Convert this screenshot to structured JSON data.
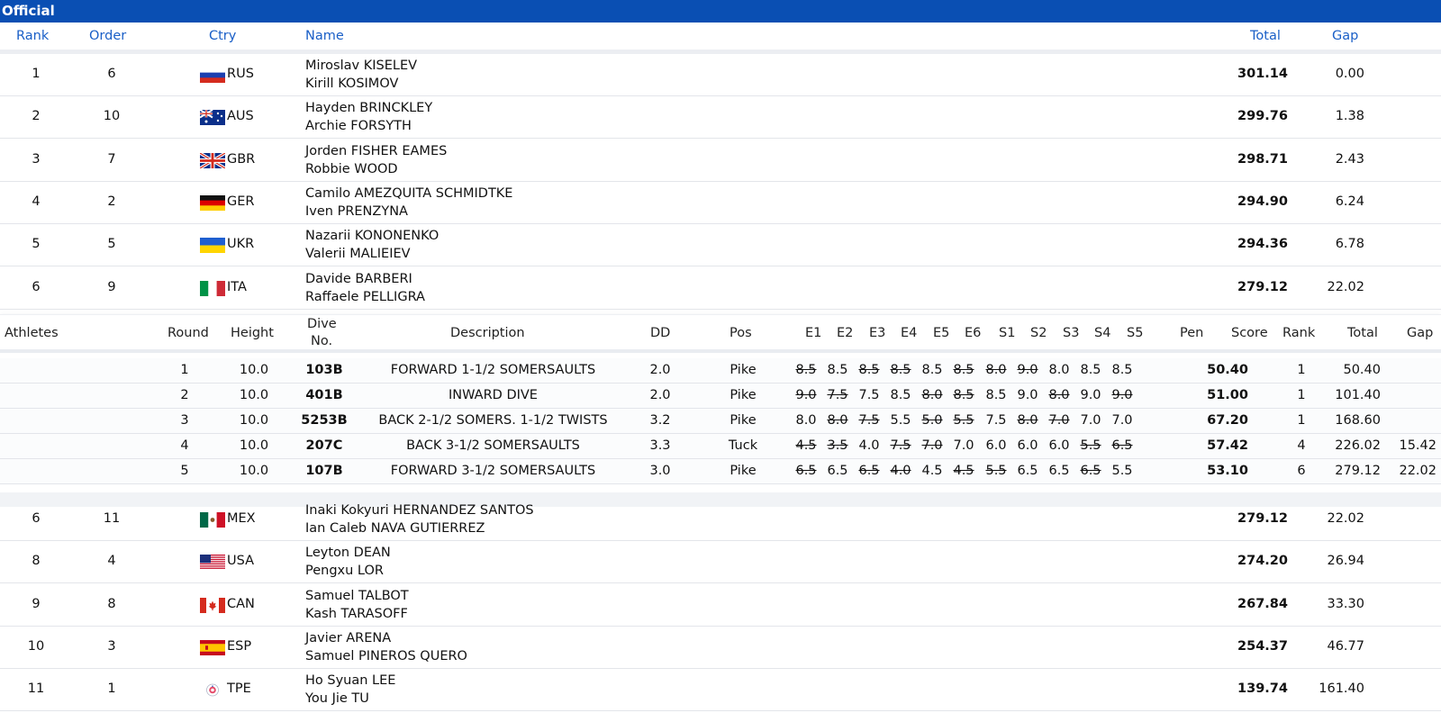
{
  "banner": {
    "title": "Official"
  },
  "columns": {
    "rank": "Rank",
    "order": "Order",
    "ctry": "Ctry",
    "name": "Name",
    "total": "Total",
    "gap": "Gap"
  },
  "results_top": [
    {
      "rank": "1",
      "order": "6",
      "ctry": "RUS",
      "name1": "Miroslav KISELEV",
      "name2": "Kirill KOSIMOV",
      "total": "301.14",
      "gap": "0.00"
    },
    {
      "rank": "2",
      "order": "10",
      "ctry": "AUS",
      "name1": "Hayden BRINCKLEY",
      "name2": "Archie FORSYTH",
      "total": "299.76",
      "gap": "1.38"
    },
    {
      "rank": "3",
      "order": "7",
      "ctry": "GBR",
      "name1": "Jorden FISHER EAMES",
      "name2": "Robbie WOOD",
      "total": "298.71",
      "gap": "2.43"
    },
    {
      "rank": "4",
      "order": "2",
      "ctry": "GER",
      "name1": "Camilo AMEZQUITA SCHMIDTKE",
      "name2": "Iven PRENZYNA",
      "total": "294.90",
      "gap": "6.24"
    },
    {
      "rank": "5",
      "order": "5",
      "ctry": "UKR",
      "name1": "Nazarii KONONENKO",
      "name2": "Valerii MALIEIEV",
      "total": "294.36",
      "gap": "6.78"
    },
    {
      "rank": "6",
      "order": "9",
      "ctry": "ITA",
      "name1": "Davide BARBERI",
      "name2": "Raffaele PELLIGRA",
      "total": "279.12",
      "gap": "22.02"
    }
  ],
  "detail": {
    "headers": {
      "athletes": "Athletes",
      "round": "Round",
      "height": "Height",
      "dive_no_1": "Dive",
      "dive_no_2": "No.",
      "description": "Description",
      "dd": "DD",
      "pos": "Pos",
      "e1": "E1",
      "e2": "E2",
      "e3": "E3",
      "e4": "E4",
      "e5": "E5",
      "e6": "E6",
      "s1": "S1",
      "s2": "S2",
      "s3": "S3",
      "s4": "S4",
      "s5": "S5",
      "pen": "Pen",
      "score": "Score",
      "rank": "Rank",
      "total": "Total",
      "gap": "Gap"
    },
    "rows": [
      {
        "round": "1",
        "height": "10.0",
        "dive": "103B",
        "desc": "FORWARD 1-1/2 SOMERSAULTS",
        "dd": "2.0",
        "pos": "Pike",
        "marks": [
          "8.5",
          "8.5",
          "8.5",
          "8.5",
          "8.5",
          "8.5",
          "8.0",
          "9.0",
          "8.0",
          "8.5",
          "8.5"
        ],
        "score": "50.40",
        "rank": "1",
        "total": "50.40",
        "gap": ""
      },
      {
        "round": "2",
        "height": "10.0",
        "dive": "401B",
        "desc": "INWARD DIVE",
        "dd": "2.0",
        "pos": "Pike",
        "marks": [
          "9.0",
          "7.5",
          "7.5",
          "8.5",
          "8.0",
          "8.5",
          "8.5",
          "9.0",
          "8.0",
          "9.0",
          "9.0"
        ],
        "score": "51.00",
        "rank": "1",
        "total": "101.40",
        "gap": ""
      },
      {
        "round": "3",
        "height": "10.0",
        "dive": "5253B",
        "desc": "BACK 2-1/2 SOMERS. 1-1/2 TWISTS",
        "dd": "3.2",
        "pos": "Pike",
        "marks": [
          "8.0",
          "8.0",
          "7.5",
          "5.5",
          "5.0",
          "5.5",
          "7.5",
          "8.0",
          "7.0",
          "7.0",
          "7.0"
        ],
        "score": "67.20",
        "rank": "1",
        "total": "168.60",
        "gap": ""
      },
      {
        "round": "4",
        "height": "10.0",
        "dive": "207C",
        "desc": "BACK 3-1/2 SOMERSAULTS",
        "dd": "3.3",
        "pos": "Tuck",
        "marks": [
          "4.5",
          "3.5",
          "4.0",
          "7.5",
          "7.0",
          "7.0",
          "6.0",
          "6.0",
          "6.0",
          "5.5",
          "6.5"
        ],
        "score": "57.42",
        "rank": "4",
        "total": "226.02",
        "gap": "15.42"
      },
      {
        "round": "5",
        "height": "10.0",
        "dive": "107B",
        "desc": "FORWARD 3-1/2 SOMERSAULTS",
        "dd": "3.0",
        "pos": "Pike",
        "marks": [
          "6.5",
          "6.5",
          "6.5",
          "4.0",
          "4.5",
          "4.5",
          "5.5",
          "6.5",
          "6.5",
          "6.5",
          "5.5"
        ],
        "score": "53.10",
        "rank": "6",
        "total": "279.12",
        "gap": "22.02"
      }
    ]
  },
  "results_bottom": [
    {
      "rank": "6",
      "order": "11",
      "ctry": "MEX",
      "name1": "Inaki Kokyuri HERNANDEZ SANTOS",
      "name2": "Ian Caleb NAVA GUTIERREZ",
      "total": "279.12",
      "gap": "22.02"
    },
    {
      "rank": "8",
      "order": "4",
      "ctry": "USA",
      "name1": "Leyton DEAN",
      "name2": "Pengxu LOR",
      "total": "274.20",
      "gap": "26.94"
    },
    {
      "rank": "9",
      "order": "8",
      "ctry": "CAN",
      "name1": "Samuel TALBOT",
      "name2": "Kash TARASOFF",
      "total": "267.84",
      "gap": "33.30"
    },
    {
      "rank": "10",
      "order": "3",
      "ctry": "ESP",
      "name1": "Javier ARENA",
      "name2": "Samuel PINEROS QUERO",
      "total": "254.37",
      "gap": "46.77"
    },
    {
      "rank": "11",
      "order": "1",
      "ctry": "TPE",
      "name1": "Ho Syuan LEE",
      "name2": "You Jie TU",
      "total": "139.74",
      "gap": "161.40"
    }
  ]
}
